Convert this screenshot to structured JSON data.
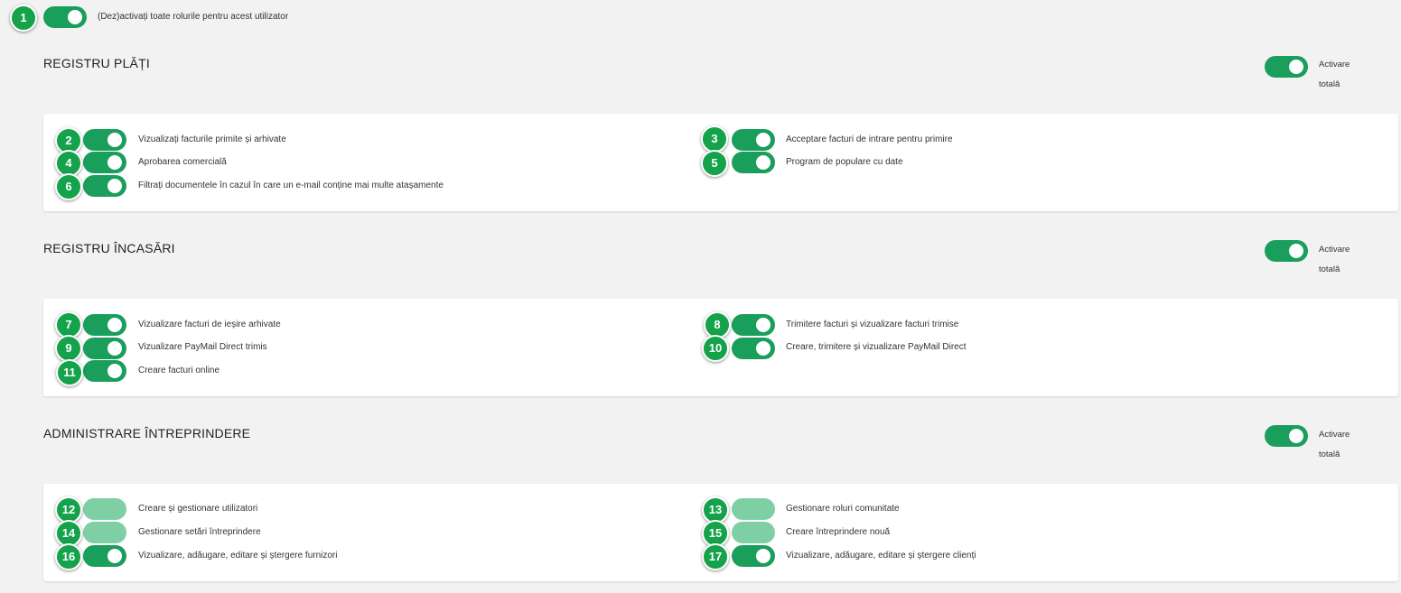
{
  "master": {
    "badge": "1",
    "label": "(Dez)activați toate rolurile pentru acest utilizator"
  },
  "sections": [
    {
      "title": "REGISTRU PLĂȚI",
      "total_label_line1": "Activare",
      "total_label_line2": "totală",
      "roles": [
        {
          "badge": "2",
          "label": "Vizualizați facturile primite și arhivate"
        },
        {
          "badge": "3",
          "label": "Acceptare facturi de intrare pentru primire"
        },
        {
          "badge": "4",
          "label": "Aprobarea comercială"
        },
        {
          "badge": "5",
          "label": "Program de populare cu date"
        },
        {
          "badge": "6",
          "label": "Filtrați documentele în cazul în care un e-mail conține mai multe atașamente"
        }
      ]
    },
    {
      "title": "REGISTRU ÎNCASĂRI",
      "total_label_line1": "Activare",
      "total_label_line2": "totală",
      "roles": [
        {
          "badge": "7",
          "label": "Vizualizare facturi de ieșire arhivate"
        },
        {
          "badge": "8",
          "label": "Trimitere facturi și vizualizare facturi trimise"
        },
        {
          "badge": "9",
          "label": "Vizualizare PayMail Direct trimis"
        },
        {
          "badge": "10",
          "label": "Creare, trimitere și vizualizare PayMail Direct"
        },
        {
          "badge": "11",
          "label": "Creare facturi online"
        }
      ]
    },
    {
      "title": "ADMINISTRARE ÎNTREPRINDERE",
      "total_label_line1": "Activare",
      "total_label_line2": "totală",
      "roles": [
        {
          "badge": "12",
          "label": "Creare și gestionare utilizatori"
        },
        {
          "badge": "13",
          "label": "Gestionare roluri comunitate"
        },
        {
          "badge": "14",
          "label": "Gestionare setări întreprindere"
        },
        {
          "badge": "15",
          "label": "Creare întreprindere nouă"
        },
        {
          "badge": "16",
          "label": "Vizualizare, adăugare, editare și ștergere furnizori"
        },
        {
          "badge": "17",
          "label": "Vizualizare, adăugare, editare și ștergere clienți"
        }
      ]
    }
  ],
  "colors": {
    "toggle_on": "#1a9e5c",
    "toggle_disabled": "#7fcfa5",
    "badge_bg": "#14a24a",
    "page_bg": "#f2f2f2"
  }
}
